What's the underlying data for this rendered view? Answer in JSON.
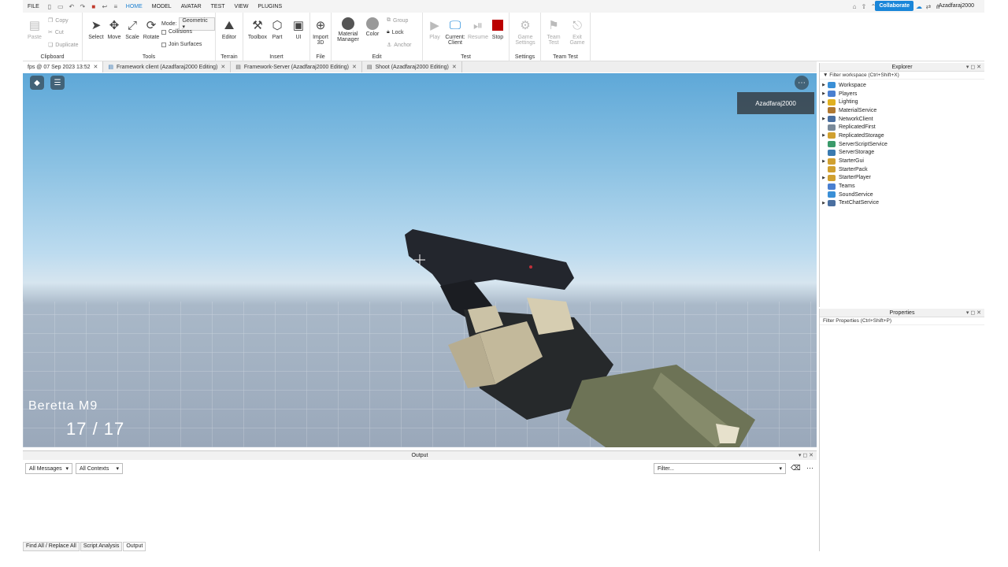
{
  "menubar": {
    "items": [
      "FILE",
      "HOME",
      "MODEL",
      "AVATAR",
      "TEST",
      "VIEW",
      "PLUGINS"
    ],
    "active": "HOME",
    "collaborate": "Collaborate",
    "user": "Azadfaraj2000"
  },
  "ribbon": {
    "clipboard": {
      "paste": "Paste",
      "copy": "Copy",
      "cut": "Cut",
      "duplicate": "Duplicate",
      "label": "Clipboard"
    },
    "tools": {
      "select": "Select",
      "move": "Move",
      "scale": "Scale",
      "rotate": "Rotate",
      "mode_label": "Mode:",
      "mode_value": "Geometric",
      "collisions": "Collisions",
      "join_surfaces": "Join Surfaces",
      "label": "Tools"
    },
    "terrain": {
      "editor": "Editor",
      "label": "Terrain"
    },
    "insert": {
      "toolbox": "Toolbox",
      "part": "Part",
      "ui": "UI",
      "label": "Insert"
    },
    "file": {
      "import3d_1": "Import",
      "import3d_2": "3D",
      "label": "File"
    },
    "edit": {
      "material_1": "Material",
      "material_2": "Manager",
      "color": "Color",
      "group": "Group",
      "lock": "Lock",
      "anchor": "Anchor",
      "label": "Edit"
    },
    "test": {
      "play": "Play",
      "current_1": "Current:",
      "current_2": "Client",
      "resume": "Resume",
      "stop": "Stop",
      "label": "Test"
    },
    "settings": {
      "game_1": "Game",
      "game_2": "Settings",
      "label": "Settings"
    },
    "team_test": {
      "team_1": "Team",
      "team_2": "Test",
      "exit_1": "Exit",
      "exit_2": "Game",
      "label": "Team Test"
    }
  },
  "tabs": [
    {
      "label": "fps @ 07 Sep 2023 13:52"
    },
    {
      "label": "Framework client (Azadfaraj2000 Editing)"
    },
    {
      "label": "Framework-Server (Azadfaraj2000 Editing)"
    },
    {
      "label": "Shoot (Azadfaraj2000 Editing)"
    }
  ],
  "viewport": {
    "player": "Azadfaraj2000",
    "gun_name": "Beretta M9",
    "ammo": "17 / 17"
  },
  "output": {
    "title": "Output",
    "messages": "All Messages",
    "contexts": "All Contexts",
    "filter": "Filter..."
  },
  "bottom_tabs": [
    "Find All / Replace All",
    "Script Analysis",
    "Output"
  ],
  "explorer": {
    "title": "Explorer",
    "filter": "Filter workspace (Ctrl+Shift+X)",
    "items": [
      {
        "label": "Workspace",
        "expand": true,
        "color": "#3a8fd6"
      },
      {
        "label": "Players",
        "expand": true,
        "color": "#4a7fd0"
      },
      {
        "label": "Lighting",
        "expand": true,
        "color": "#e0b020"
      },
      {
        "label": "MaterialService",
        "expand": false,
        "color": "#b07830"
      },
      {
        "label": "NetworkClient",
        "expand": true,
        "color": "#4a6fa0"
      },
      {
        "label": "ReplicatedFirst",
        "expand": false,
        "color": "#7a8a9a"
      },
      {
        "label": "ReplicatedStorage",
        "expand": true,
        "color": "#d0a030"
      },
      {
        "label": "ServerScriptService",
        "expand": false,
        "color": "#3a9a6a"
      },
      {
        "label": "ServerStorage",
        "expand": false,
        "color": "#3a7ab0"
      },
      {
        "label": "StarterGui",
        "expand": true,
        "color": "#d0a030"
      },
      {
        "label": "StarterPack",
        "expand": false,
        "color": "#d0a030"
      },
      {
        "label": "StarterPlayer",
        "expand": true,
        "color": "#d0a030"
      },
      {
        "label": "Teams",
        "expand": false,
        "color": "#4a7fd0"
      },
      {
        "label": "SoundService",
        "expand": false,
        "color": "#3a8fd6"
      },
      {
        "label": "TextChatService",
        "expand": true,
        "color": "#4a6fa0"
      }
    ]
  },
  "properties": {
    "title": "Properties",
    "filter": "Filter Properties (Ctrl+Shift+P)"
  }
}
